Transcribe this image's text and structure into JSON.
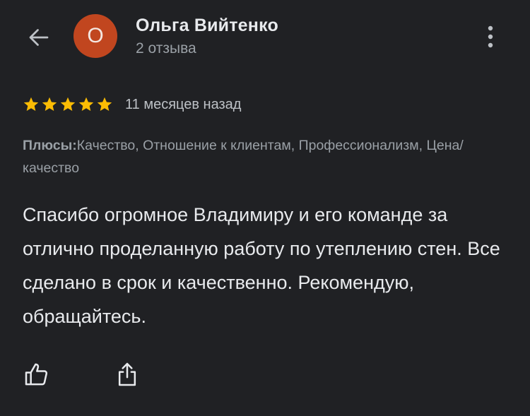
{
  "header": {
    "back_icon": "arrow-left-icon",
    "avatar_letter": "О",
    "avatar_color": "#c1461f",
    "user_name": "Ольга Вийтенко",
    "review_count": "2 отзыва",
    "more_icon": "more-vertical-icon"
  },
  "review": {
    "rating": 5,
    "rating_max": 5,
    "star_color": "#fbbc04",
    "date": "11 месяцев назад",
    "pros_label": "Плюсы:",
    "pros_text": "Качество, Отношение к клиентам, Профессионализм, Цена/качество",
    "text": "Спасибо огромное Владимиру и его команде за отлично проделанную работу по утеплению стен. Все сделано в срок и качественно. Рекомендую, обращайтесь."
  },
  "actions": {
    "like_icon": "thumbs-up-icon",
    "share_icon": "share-icon"
  }
}
